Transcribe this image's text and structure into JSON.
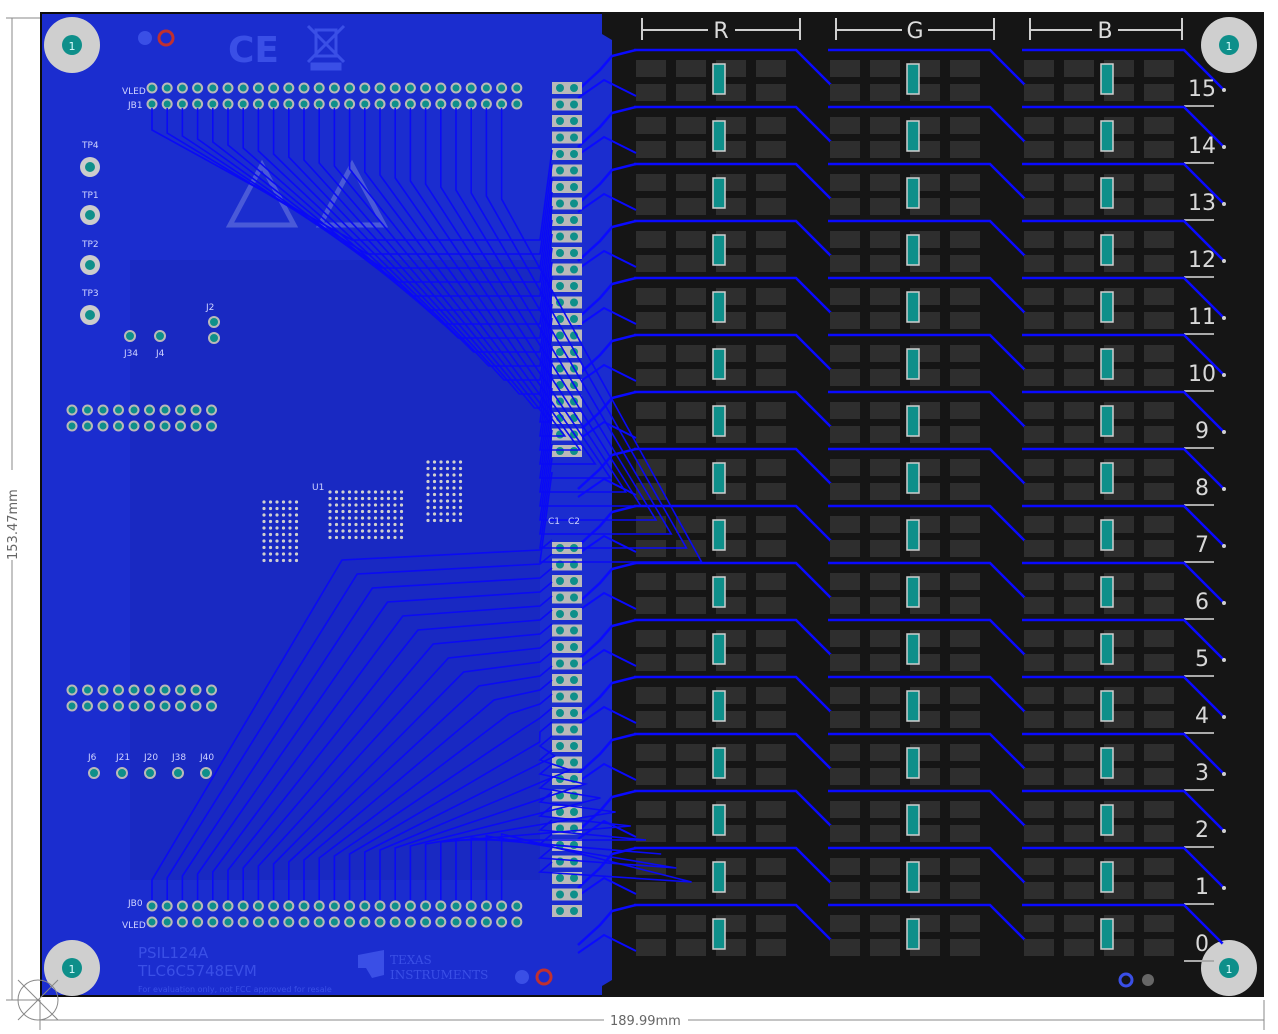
{
  "board": {
    "name_line1": "PSIL124A",
    "name_line2": "TLC6C5748EVM",
    "footer_note": "For evaluation only, not FCC approved for resale",
    "manufacturer_line1": "TEXAS",
    "manufacturer_line2": "INSTRUMENTS",
    "ce_mark": "CE",
    "width_dimension": "189.99mm",
    "height_dimension": "153.47mm"
  },
  "fiducials": {
    "mounting_hole_label": "1"
  },
  "connectors": {
    "top_header": "JB1",
    "top_header_pin_label": "VLED",
    "bottom_header": "JB0",
    "bottom_header_pin_label": "VLED",
    "test_points": [
      "TP4",
      "TP1",
      "TP2",
      "TP3"
    ],
    "jumpers": [
      "J34",
      "J4",
      "J2"
    ],
    "bottom_jumpers": [
      "J6",
      "J21",
      "J20",
      "J38",
      "J40"
    ],
    "module": "U1",
    "capacitors": [
      "C1",
      "C2"
    ]
  },
  "color_columns": [
    "R",
    "G",
    "B"
  ],
  "row_numbers": [
    "15",
    "14",
    "13",
    "12",
    "11",
    "10",
    "9",
    "8",
    "7",
    "6",
    "5",
    "4",
    "3",
    "2",
    "1",
    "0"
  ],
  "colors": {
    "copper_top": "#1f1fd9",
    "copper_trace": "#0a0aff",
    "board_blue": "#1c2fc4",
    "pad_dark": "#3a3a3a",
    "led_area": "#111111",
    "silkscreen": "#c8c8c8"
  }
}
